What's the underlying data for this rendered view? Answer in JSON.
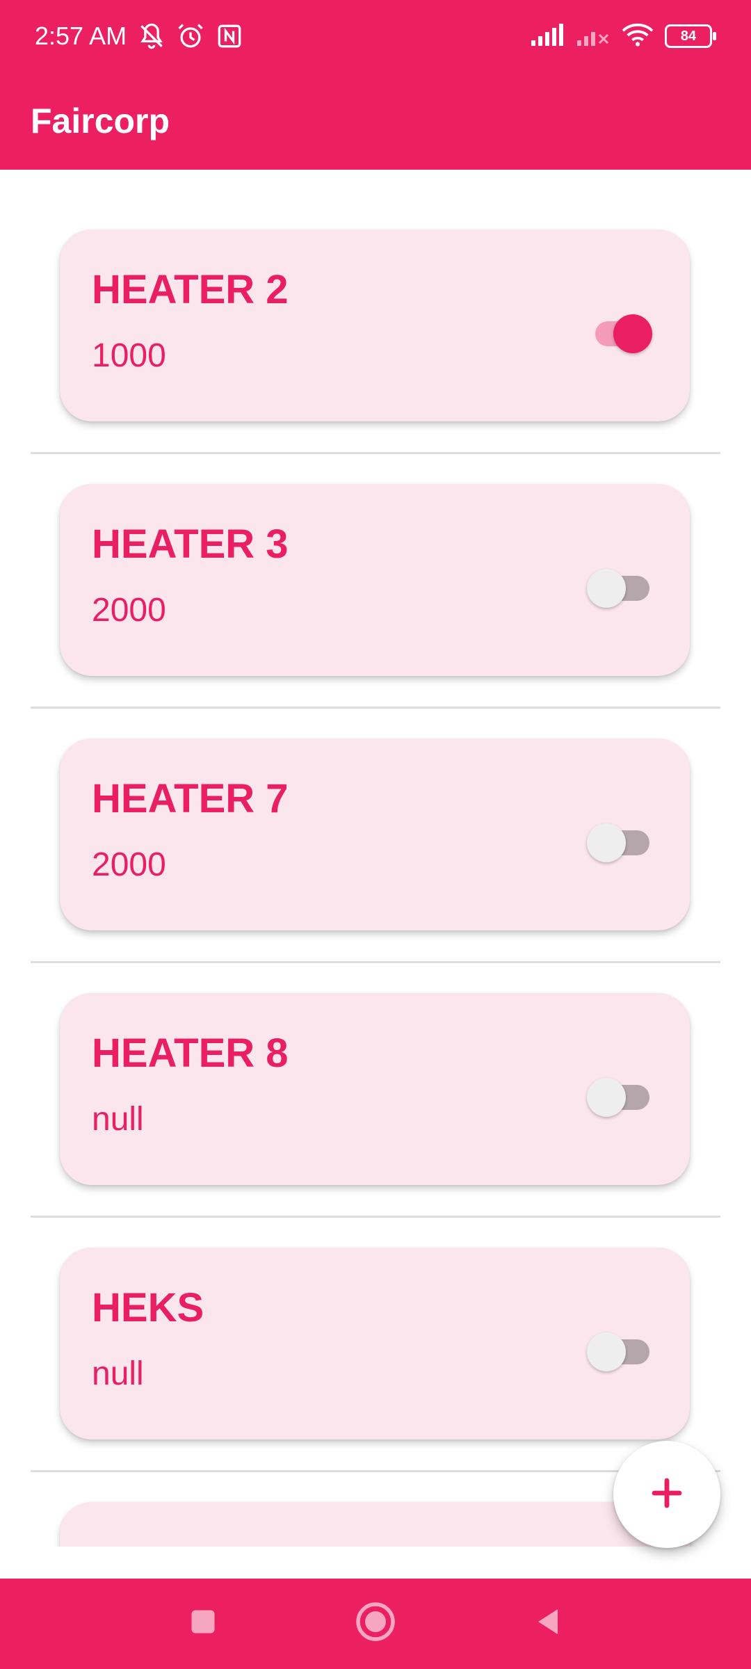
{
  "status_bar": {
    "time": "2:57 AM",
    "battery": "84",
    "left_icons": [
      "bell-off-icon",
      "alarm-icon",
      "nfc-icon"
    ],
    "right_icons": [
      "signal-icon",
      "signal-off-icon",
      "wifi-icon",
      "battery-icon"
    ]
  },
  "app_bar": {
    "title": "Faircorp"
  },
  "colors": {
    "primary": "#EC1F63",
    "accent": "#E91E63",
    "card": "#FCE6ED"
  },
  "heaters": [
    {
      "name": "HEATER 2",
      "power": "1000",
      "on": true
    },
    {
      "name": "HEATER 3",
      "power": "2000",
      "on": false
    },
    {
      "name": "HEATER 7",
      "power": "2000",
      "on": false
    },
    {
      "name": "HEATER 8",
      "power": "null",
      "on": false
    },
    {
      "name": "HEKS",
      "power": "null",
      "on": false
    }
  ],
  "fab": {
    "icon": "plus-icon"
  },
  "nav": {
    "icons": [
      "recents-icon",
      "home-icon",
      "back-icon"
    ]
  }
}
